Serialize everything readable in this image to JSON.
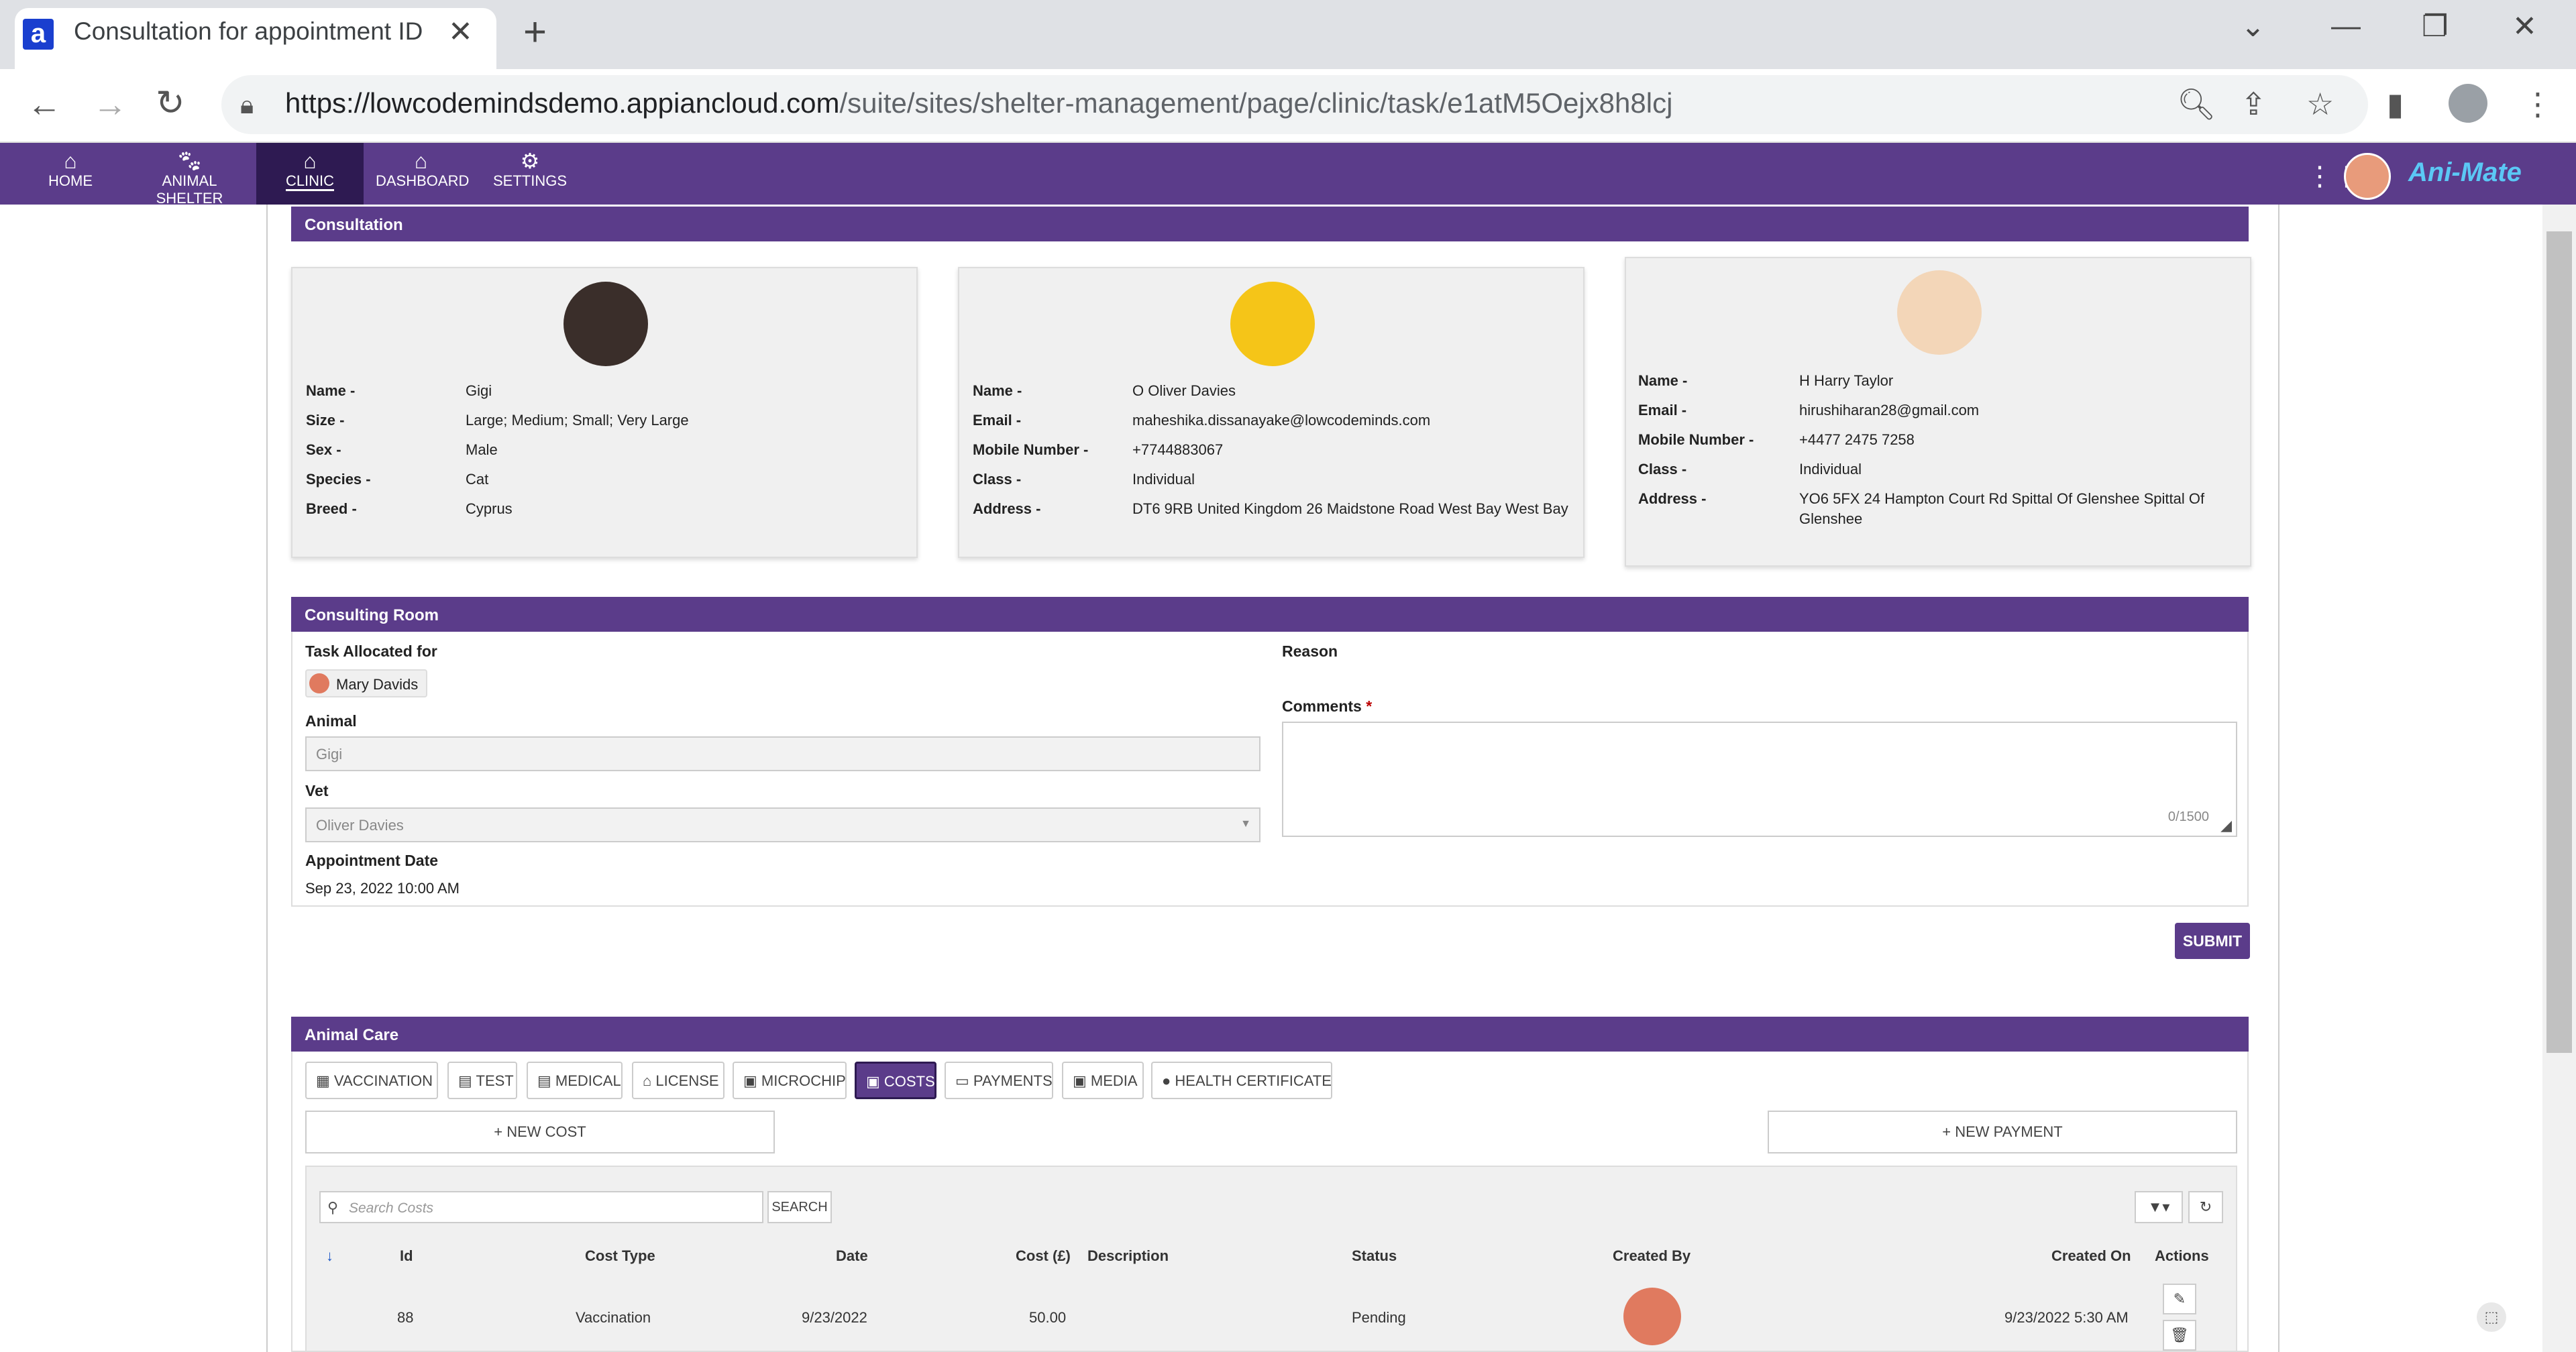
{
  "browser": {
    "tab_title": "Consultation for appointment ID",
    "url_host": "https://lowcodemindsdemo.appiancloud.com",
    "url_path": "/suite/sites/shelter-management/page/clinic/task/e1atM5Oejx8h8lcj"
  },
  "nav": {
    "items": [
      {
        "label": "HOME",
        "icon": "home-icon"
      },
      {
        "label": "ANIMAL SHELTER",
        "icon": "paw-icon"
      },
      {
        "label": "CLINIC",
        "icon": "clinic-icon"
      },
      {
        "label": "DASHBOARD",
        "icon": "dashboard-icon"
      },
      {
        "label": "SETTINGS",
        "icon": "gear-icon"
      }
    ],
    "active": "CLINIC",
    "logo": "Ani-Mate"
  },
  "consultation": {
    "title": "Consultation",
    "animal": {
      "name_k": "Name -",
      "name": "Gigi",
      "size_k": "Size -",
      "size": "Large; Medium; Small; Very Large",
      "sex_k": "Sex -",
      "sex": "Male",
      "species_k": "Species -",
      "species": "Cat",
      "breed_k": "Breed -",
      "breed": "Cyprus"
    },
    "vet": {
      "name_k": "Name -",
      "name": "O Oliver Davies",
      "email_k": "Email -",
      "email": "maheshika.dissanayake@lowcodeminds.com",
      "mobile_k": "Mobile Number -",
      "mobile": "+7744883067",
      "class_k": "Class -",
      "class": "Individual",
      "address_k": "Address -",
      "address": "DT6 9RB United Kingdom 26 Maidstone Road West Bay West Bay"
    },
    "owner": {
      "name_k": "Name -",
      "name": "H Harry Taylor",
      "email_k": "Email -",
      "email": "hirushiharan28@gmail.com",
      "mobile_k": "Mobile Number -",
      "mobile": "+4477 2475 7258",
      "class_k": "Class -",
      "class": "Individual",
      "address_k": "Address -",
      "address_1": "YO6 5FX  24 Hampton Court Rd Spittal Of Glenshee Spittal Of",
      "address_2": "Glenshee"
    }
  },
  "room": {
    "title": "Consulting Room",
    "task_label": "Task Allocated for",
    "task_user": "Mary Davids",
    "animal_label": "Animal",
    "animal_value": "Gigi",
    "vet_label": "Vet",
    "vet_value": "Oliver Davies",
    "appt_label": "Appointment Date",
    "appt_value": "Sep 23, 2022 10:00 AM",
    "reason_label": "Reason",
    "comments_label": "Comments",
    "comments_required": "*",
    "comments_count": "0/1500",
    "submit": "SUBMIT"
  },
  "care": {
    "title": "Animal Care",
    "tabs": [
      "VACCINATION",
      "TEST",
      "MEDICAL",
      "LICENSE",
      "MICROCHIP",
      "COSTS",
      "PAYMENTS",
      "MEDIA",
      "HEALTH CERTIFICATE"
    ],
    "active_tab": "COSTS",
    "new_cost": "+ NEW COST",
    "new_payment": "+ NEW PAYMENT",
    "search_placeholder": "Search Costs",
    "search_btn": "SEARCH",
    "columns": [
      "Id",
      "Cost Type",
      "Date",
      "Cost (£)",
      "Description",
      "Status",
      "Created By",
      "Created On",
      "Actions"
    ],
    "rows": [
      {
        "id": "88",
        "type": "Vaccination",
        "date": "9/23/2022",
        "cost": "50.00",
        "desc": "",
        "status": "Pending",
        "created_on": "9/23/2022 5:30 AM"
      }
    ]
  }
}
